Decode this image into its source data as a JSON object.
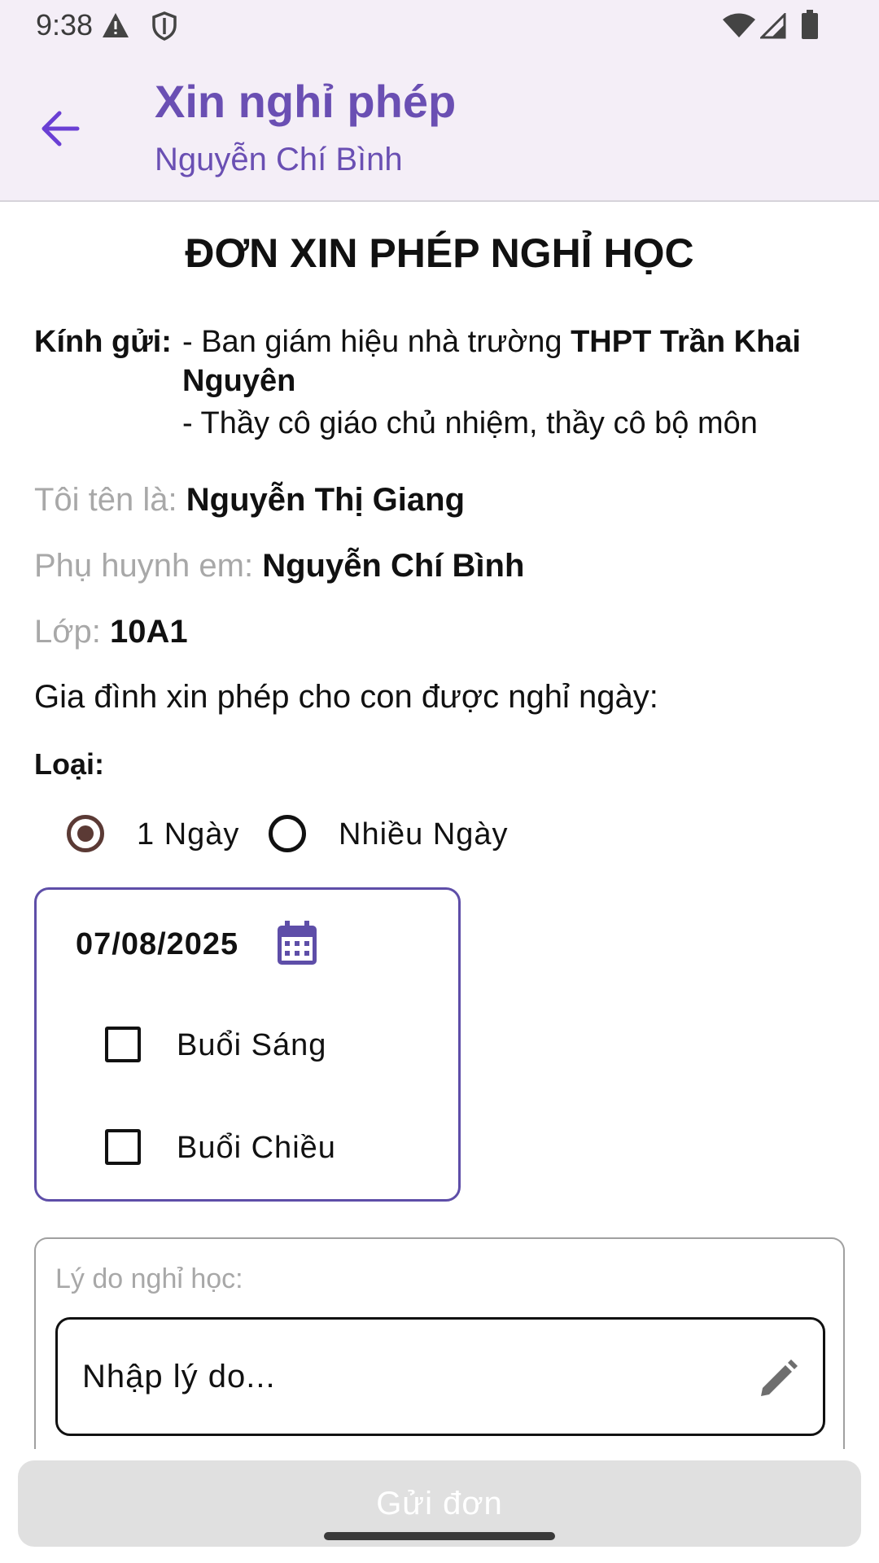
{
  "status_bar": {
    "time": "9:38",
    "icons": [
      "warning-icon",
      "shield-icon",
      "wifi-icon",
      "signal-icon",
      "battery-icon"
    ]
  },
  "app_bar": {
    "title": "Xin nghỉ phép",
    "subtitle": "Nguyễn Chí Bình",
    "accent_color": "#6a4fb3"
  },
  "document": {
    "title": "ĐƠN XIN PHÉP NGHỈ HỌC",
    "recipient_label": "Kính gửi:",
    "recipient_line1_prefix": "- Ban giám hiệu nhà trường ",
    "recipient_school": "THPT Trần Khai Nguyên",
    "recipient_line2": "- Thầy cô giáo chủ nhiệm, thầy cô bộ môn",
    "name_label": "Tôi tên là:",
    "name_value": "Nguyễn Thị Giang",
    "parent_label": "Phụ huynh em:",
    "parent_value": "Nguyễn Chí Bình",
    "class_label": "Lớp:",
    "class_value": "10A1",
    "request_text": "Gia đình xin phép cho con được nghỉ ngày:",
    "type_label": "Loại:"
  },
  "leave_type": {
    "options": [
      "1 Ngày",
      "Nhiều Ngày"
    ],
    "selected": "1 Ngày"
  },
  "date_picker": {
    "value": "07/08/2025",
    "sessions": [
      {
        "label": "Buổi Sáng",
        "checked": false
      },
      {
        "label": "Buổi Chiều",
        "checked": false
      }
    ]
  },
  "reason": {
    "label": "Lý do nghỉ học:",
    "placeholder": "Nhập lý do..."
  },
  "submit": {
    "label": "Gửi đơn"
  }
}
